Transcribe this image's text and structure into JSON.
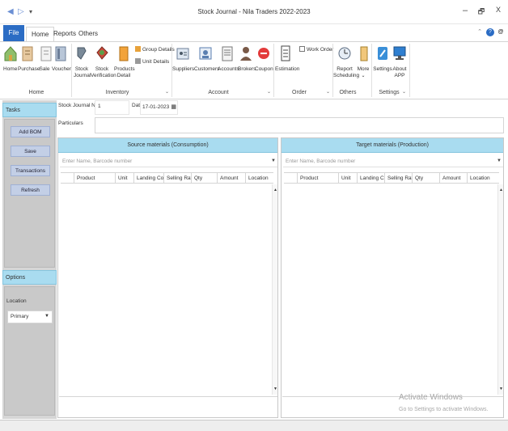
{
  "window": {
    "title": "Stock Journal - Nila Traders 2022-2023",
    "controls": [
      "–",
      "🗗",
      "X"
    ]
  },
  "ribbon": {
    "tabs": [
      "File",
      "Home",
      "Reports",
      "Others"
    ],
    "active_tab": "Home",
    "groups": {
      "home": {
        "label": "Home",
        "buttons": [
          "Home",
          "Purchase",
          "Sale",
          "Voucher"
        ]
      },
      "inventory": {
        "label": "Inventory",
        "buttons": [
          "Stock\nJournal",
          "Stock\nVerification",
          "Products\nDetail"
        ],
        "small": [
          "Group Details",
          "Unit Details"
        ]
      },
      "account": {
        "label": "Account",
        "buttons": [
          "Suppliers",
          "Customers",
          "Accounts",
          "Brokers",
          "Coupon"
        ]
      },
      "order": {
        "label": "Order",
        "buttons": [
          "Estimation"
        ],
        "small": [
          "Work Order"
        ]
      },
      "others": {
        "label": "Others",
        "buttons": [
          "Report\nScheduling",
          "More"
        ]
      },
      "settings": {
        "label": "Settings",
        "buttons": [
          "Settings",
          "About\nAPP"
        ]
      }
    }
  },
  "left_panel": {
    "tasks_title": "Tasks",
    "buttons": [
      "Add BOM",
      "Save",
      "Transactions",
      "Refresh"
    ],
    "options_title": "Options",
    "location_label": "Location",
    "location_value": "Primary"
  },
  "form": {
    "stock_journal_no_label": "Stock Journal No",
    "stock_journal_no_value": "1",
    "date_label": "Date",
    "date_value": "17-01-2023",
    "particulars_label": "Particulars",
    "particulars_value": ""
  },
  "source_grid": {
    "title": "Source materials (Consumption)",
    "search_placeholder": "Enter Name, Barcode number",
    "columns": [
      "Product",
      "Unit",
      "Landing Cost",
      "Selling Rate",
      "Qty",
      "Amount",
      "Location"
    ]
  },
  "target_grid": {
    "title": "Target materials (Production)",
    "search_placeholder": "Enter Name, Barcode number",
    "columns": [
      "Product",
      "Unit",
      "Landing C...",
      "Selling Rate",
      "Qty",
      "Amount",
      "Location"
    ]
  },
  "watermark": {
    "line1": "Activate Windows",
    "line2": "Go to Settings to activate Windows."
  }
}
